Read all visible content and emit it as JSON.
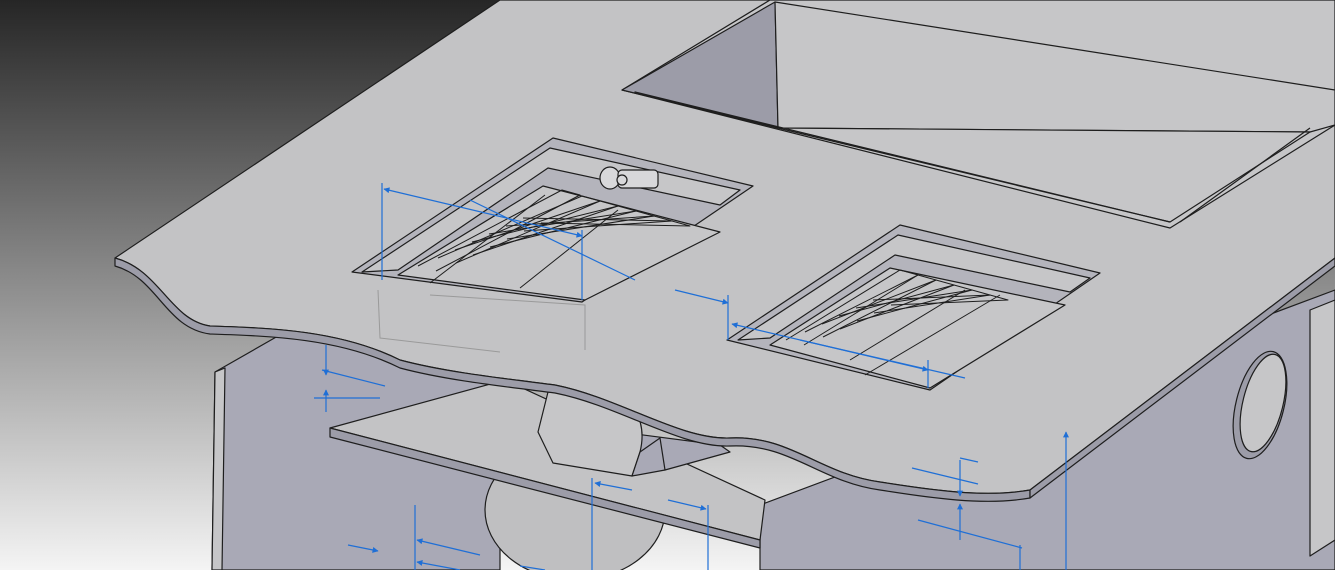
{
  "viewport": {
    "background_top": "#262626",
    "background_bottom": "#f4f4f4"
  },
  "colors": {
    "face_light": "#c6c6c8",
    "face_top": "#c3c3c5",
    "face_side": "#a9a9b6",
    "face_dark": "#9c9ca8",
    "opening_shadow": "#b4b4bc",
    "edge": "#1e1e1e",
    "dimension": "#1f6fd6",
    "hidden_line": "#9a9a9a"
  },
  "icons": {
    "dimension_arrow": "dimension-arrow-icon"
  }
}
